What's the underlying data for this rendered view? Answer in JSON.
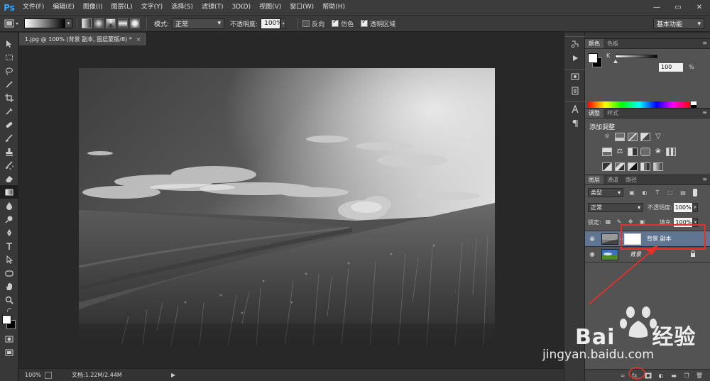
{
  "app": {
    "logo": "Ps",
    "menus": [
      "文件(F)",
      "编辑(E)",
      "图像(I)",
      "图层(L)",
      "文字(Y)",
      "选择(S)",
      "滤镜(T)",
      "3D(D)",
      "视图(V)",
      "窗口(W)",
      "帮助(H)"
    ],
    "window_controls": [
      "—",
      "▭",
      "✕"
    ]
  },
  "options_bar": {
    "mode_label": "模式:",
    "mode_value": "正常",
    "opacity_label": "不透明度:",
    "opacity_value": "100%",
    "reverse_label": "反向",
    "reverse_checked": false,
    "dither_label": "仿色",
    "dither_checked": true,
    "transparency_label": "透明区域",
    "transparency_checked": true,
    "workspace": "基本功能"
  },
  "document": {
    "tab_title": "1.jpg @ 100% (背景 副本, 图层蒙版/8) *",
    "close": "×",
    "zoom": "100%",
    "doc_info": "文档:1.22M/2.44M",
    "status_arrow": "▶"
  },
  "color_panel": {
    "tabs": [
      "颜色",
      "色板"
    ],
    "channel_label": "K",
    "value": "100",
    "unit": "%"
  },
  "adjustments_panel": {
    "tabs": [
      "调整",
      "样式"
    ],
    "title": "添加调整"
  },
  "layers_panel": {
    "tabs": [
      "图层",
      "通道",
      "路径"
    ],
    "filter_kind": "类型",
    "blend_mode": "正常",
    "opacity_label": "不透明度:",
    "opacity_value": "100%",
    "lock_label": "锁定:",
    "fill_label": "填充:",
    "fill_value": "100%",
    "layers": [
      {
        "name": "背景 副本",
        "selected": true,
        "has_mask": true
      },
      {
        "name": "背景",
        "selected": false,
        "has_mask": false,
        "locked": true
      }
    ],
    "footer_fx": "fx."
  },
  "icons": {
    "menu": "≡",
    "dropdown": "▾",
    "eye": "◉",
    "lock": "🔒"
  },
  "watermark": {
    "brand": "Bai",
    "brand_cn": "经验",
    "url": "jingyan.baidu.com"
  },
  "colors": {
    "accent_blue": "#31a8ff",
    "annotation_red": "#e8302a",
    "selected_layer": "#5f7591"
  }
}
